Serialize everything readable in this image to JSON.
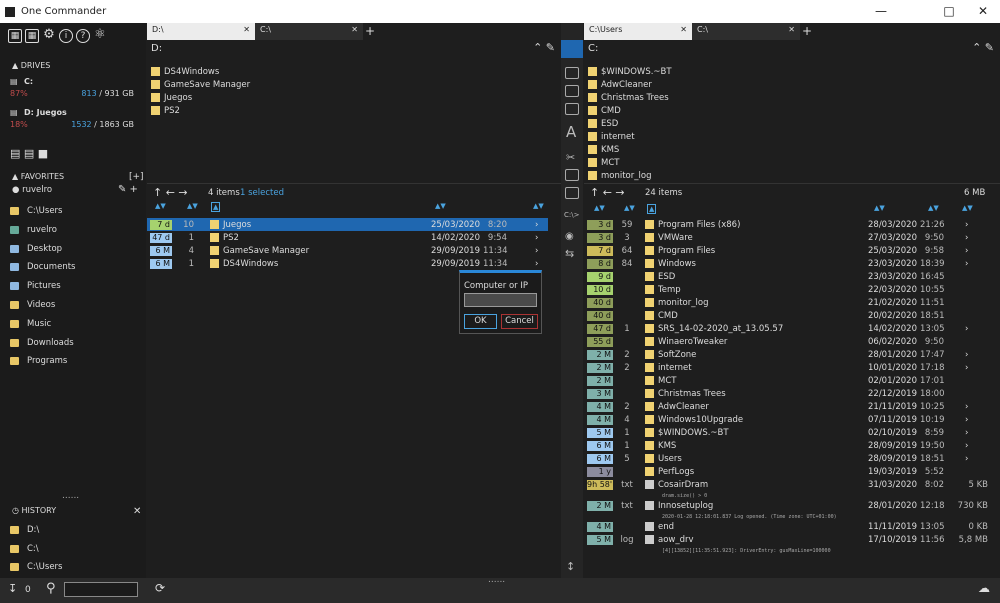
{
  "window": {
    "title": "One Commander"
  },
  "sidebar": {
    "drives_title": "DRIVES",
    "drives": [
      {
        "name": "C:",
        "percent": "87%",
        "free": "813",
        "total": "/ 931 GB"
      },
      {
        "name": "D:  Juegos",
        "percent": "18%",
        "free": "1532",
        "total": "/ 1863 GB"
      }
    ],
    "favorites_title": "FAVORITES",
    "favorites_add": "[+]",
    "user": "ruvelro",
    "favorites": [
      "C:\\Users",
      "ruvelro",
      "Desktop",
      "Documents",
      "Pictures",
      "Videos",
      "Music",
      "Downloads",
      "Programs"
    ],
    "history_title": "HISTORY",
    "history": [
      "D:\\",
      "C:\\",
      "C:\\Users"
    ],
    "dots": "......"
  },
  "left": {
    "tabs": [
      "D:\\",
      "C:\\"
    ],
    "path": "D:",
    "top_files": [
      "DS4Windows",
      "GameSave Manager",
      "Juegos",
      "PS2"
    ],
    "items_count": "4 items",
    "selected": "1 selected",
    "rows": [
      {
        "age": "7 d",
        "cls": "g",
        "count": "10",
        "name": "Juegos",
        "date": "25/03/2020",
        "time": "8:20"
      },
      {
        "age": "47 d",
        "cls": "b",
        "count": "1",
        "name": "PS2",
        "date": "14/02/2020",
        "time": "9:54"
      },
      {
        "age": "6 M",
        "cls": "b",
        "count": "4",
        "name": "GameSave Manager",
        "date": "29/09/2019",
        "time": "11:34"
      },
      {
        "age": "6 M",
        "cls": "b",
        "count": "1",
        "name": "DS4Windows",
        "date": "29/09/2019",
        "time": "11:34"
      }
    ]
  },
  "dialog": {
    "label": "Computer or IP",
    "ok": "OK",
    "cancel": "Cancel",
    "input_value": ""
  },
  "right": {
    "tabs": [
      "C:\\Users",
      "C:\\"
    ],
    "path": "C:",
    "top_files": [
      "$WINDOWS.~BT",
      "AdwCleaner",
      "Christmas Trees",
      "CMD",
      "ESD",
      "internet",
      "KMS",
      "MCT",
      "monitor_log"
    ],
    "items_count": "24 items",
    "size": "6 MB",
    "rows": [
      {
        "age": "3 d",
        "cls": "o",
        "count": "59",
        "name": "Program Files (x86)",
        "date": "28/03/2020",
        "time": "21:26",
        "arrow": true,
        "size": "",
        "sub": ""
      },
      {
        "age": "3 d",
        "cls": "o",
        "count": "3",
        "name": "VMWare",
        "date": "27/03/2020",
        "time": "9:50",
        "arrow": true,
        "size": "",
        "sub": ""
      },
      {
        "age": "7 d",
        "cls": "y",
        "count": "64",
        "name": "Program Files",
        "date": "25/03/2020",
        "time": "9:58",
        "arrow": true,
        "size": "",
        "sub": ""
      },
      {
        "age": "8 d",
        "cls": "o",
        "count": "84",
        "name": "Windows",
        "date": "23/03/2020",
        "time": "18:39",
        "arrow": true,
        "size": "",
        "sub": ""
      },
      {
        "age": "9 d",
        "cls": "g",
        "count": "",
        "name": "ESD",
        "date": "23/03/2020",
        "time": "16:45",
        "arrow": false,
        "size": "",
        "sub": ""
      },
      {
        "age": "10 d",
        "cls": "g",
        "count": "",
        "name": "Temp",
        "date": "22/03/2020",
        "time": "10:55",
        "arrow": false,
        "size": "",
        "sub": ""
      },
      {
        "age": "40 d",
        "cls": "o",
        "count": "",
        "name": "monitor_log",
        "date": "21/02/2020",
        "time": "11:51",
        "arrow": false,
        "size": "",
        "sub": ""
      },
      {
        "age": "40 d",
        "cls": "o",
        "count": "",
        "name": "CMD",
        "date": "20/02/2020",
        "time": "18:51",
        "arrow": false,
        "size": "",
        "sub": ""
      },
      {
        "age": "47 d",
        "cls": "o",
        "count": "1",
        "name": "SRS_14-02-2020_at_13.05.57",
        "date": "14/02/2020",
        "time": "13:05",
        "arrow": true,
        "size": "",
        "sub": ""
      },
      {
        "age": "55 d",
        "cls": "o",
        "count": "",
        "name": "WinaeroTweaker",
        "date": "06/02/2020",
        "time": "9:50",
        "arrow": false,
        "size": "",
        "sub": ""
      },
      {
        "age": "2 M",
        "cls": "t",
        "count": "2",
        "name": "SoftZone",
        "date": "28/01/2020",
        "time": "17:47",
        "arrow": true,
        "size": "",
        "sub": ""
      },
      {
        "age": "2 M",
        "cls": "t",
        "count": "2",
        "name": "internet",
        "date": "10/01/2020",
        "time": "17:18",
        "arrow": true,
        "size": "",
        "sub": ""
      },
      {
        "age": "2 M",
        "cls": "t",
        "count": "",
        "name": "MCT",
        "date": "02/01/2020",
        "time": "17:01",
        "arrow": false,
        "size": "",
        "sub": ""
      },
      {
        "age": "3 M",
        "cls": "t",
        "count": "",
        "name": "Christmas Trees",
        "date": "22/12/2019",
        "time": "18:00",
        "arrow": false,
        "size": "",
        "sub": ""
      },
      {
        "age": "4 M",
        "cls": "t",
        "count": "2",
        "name": "AdwCleaner",
        "date": "21/11/2019",
        "time": "10:25",
        "arrow": true,
        "size": "",
        "sub": ""
      },
      {
        "age": "4 M",
        "cls": "t",
        "count": "4",
        "name": "Windows10Upgrade",
        "date": "07/11/2019",
        "time": "10:19",
        "arrow": true,
        "size": "",
        "sub": ""
      },
      {
        "age": "5 M",
        "cls": "b",
        "count": "1",
        "name": "$WINDOWS.~BT",
        "date": "02/10/2019",
        "time": "8:59",
        "arrow": true,
        "size": "",
        "sub": ""
      },
      {
        "age": "6 M",
        "cls": "b",
        "count": "1",
        "name": "KMS",
        "date": "28/09/2019",
        "time": "19:50",
        "arrow": true,
        "size": "",
        "sub": ""
      },
      {
        "age": "6 M",
        "cls": "b",
        "count": "5",
        "name": "Users",
        "date": "28/09/2019",
        "time": "18:51",
        "arrow": true,
        "size": "",
        "sub": ""
      },
      {
        "age": "1 y",
        "cls": "p",
        "count": "",
        "name": "PerfLogs",
        "date": "19/03/2019",
        "time": "5:52",
        "arrow": false,
        "size": "",
        "sub": ""
      },
      {
        "age": "9h 58'",
        "cls": "y",
        "count": "txt",
        "name": "CosairDram",
        "date": "31/03/2020",
        "time": "8:02",
        "arrow": false,
        "size": "5 KB",
        "sub": "dram.size() > 0"
      },
      {
        "age": "2 M",
        "cls": "t",
        "count": "txt",
        "name": "Innosetuplog",
        "date": "28/01/2020",
        "time": "12:18",
        "arrow": false,
        "size": "730 KB",
        "sub": "2020-01-28 12:18:01.837   Log opened. (Time zone: UTC+01:00)"
      },
      {
        "age": "4 M",
        "cls": "t",
        "count": "",
        "name": "end",
        "date": "11/11/2019",
        "time": "13:05",
        "arrow": false,
        "size": "0 KB",
        "sub": ""
      },
      {
        "age": "5 M",
        "cls": "t",
        "count": "log",
        "name": "aow_drv",
        "date": "17/10/2019",
        "time": "11:56",
        "arrow": false,
        "size": "5,8 MB",
        "sub": "[4][13852][11:35:51.923]: DriverEntry: gusMaxLine=100000"
      }
    ]
  },
  "bottom": {
    "count": "0"
  }
}
